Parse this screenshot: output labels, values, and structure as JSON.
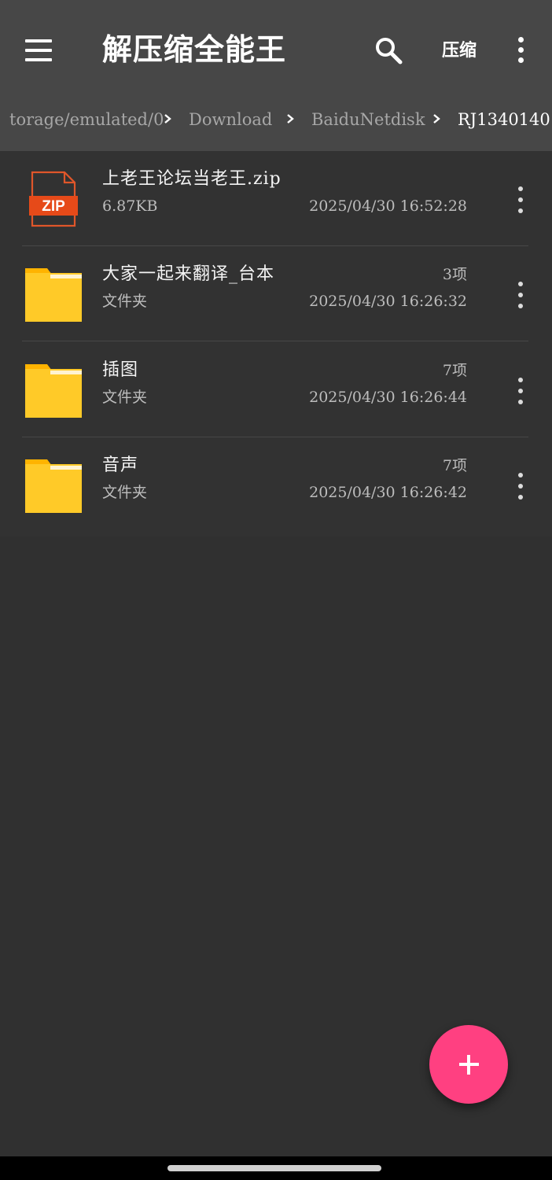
{
  "app": {
    "title": "解压缩全能王",
    "compress_label": "压缩",
    "icons": {
      "menu": "hamburger-menu-icon",
      "search": "search-icon",
      "overflow": "vertical-dots-icon",
      "separator": "chevron-right-icon",
      "fab": "plus-icon"
    },
    "colors": {
      "appbar": "#474747",
      "background": "#303030",
      "folder": "#FFCA28",
      "zip_badge": "#E64A19",
      "fab": "#FF4081"
    }
  },
  "breadcrumb": {
    "items": [
      {
        "label": "torage/emulated/0"
      },
      {
        "label": "Download"
      },
      {
        "label": "BaiduNetdisk"
      },
      {
        "label": "RJ1340140"
      }
    ]
  },
  "files": [
    {
      "type": "zip",
      "icon": "zip-file-icon",
      "badge": "ZIP",
      "name": "上老王论坛当老王.zip",
      "sub": "6.87KB",
      "count": "",
      "date": "2025/04/30  16:52:28"
    },
    {
      "type": "folder",
      "icon": "folder-icon",
      "name": "大家一起来翻译_台本",
      "sub": "文件夹",
      "count": "3项",
      "date": "2025/04/30  16:26:32"
    },
    {
      "type": "folder",
      "icon": "folder-icon",
      "name": "插图",
      "sub": "文件夹",
      "count": "7项",
      "date": "2025/04/30  16:26:44"
    },
    {
      "type": "folder",
      "icon": "folder-icon",
      "name": "音声",
      "sub": "文件夹",
      "count": "7项",
      "date": "2025/04/30  16:26:42"
    }
  ]
}
